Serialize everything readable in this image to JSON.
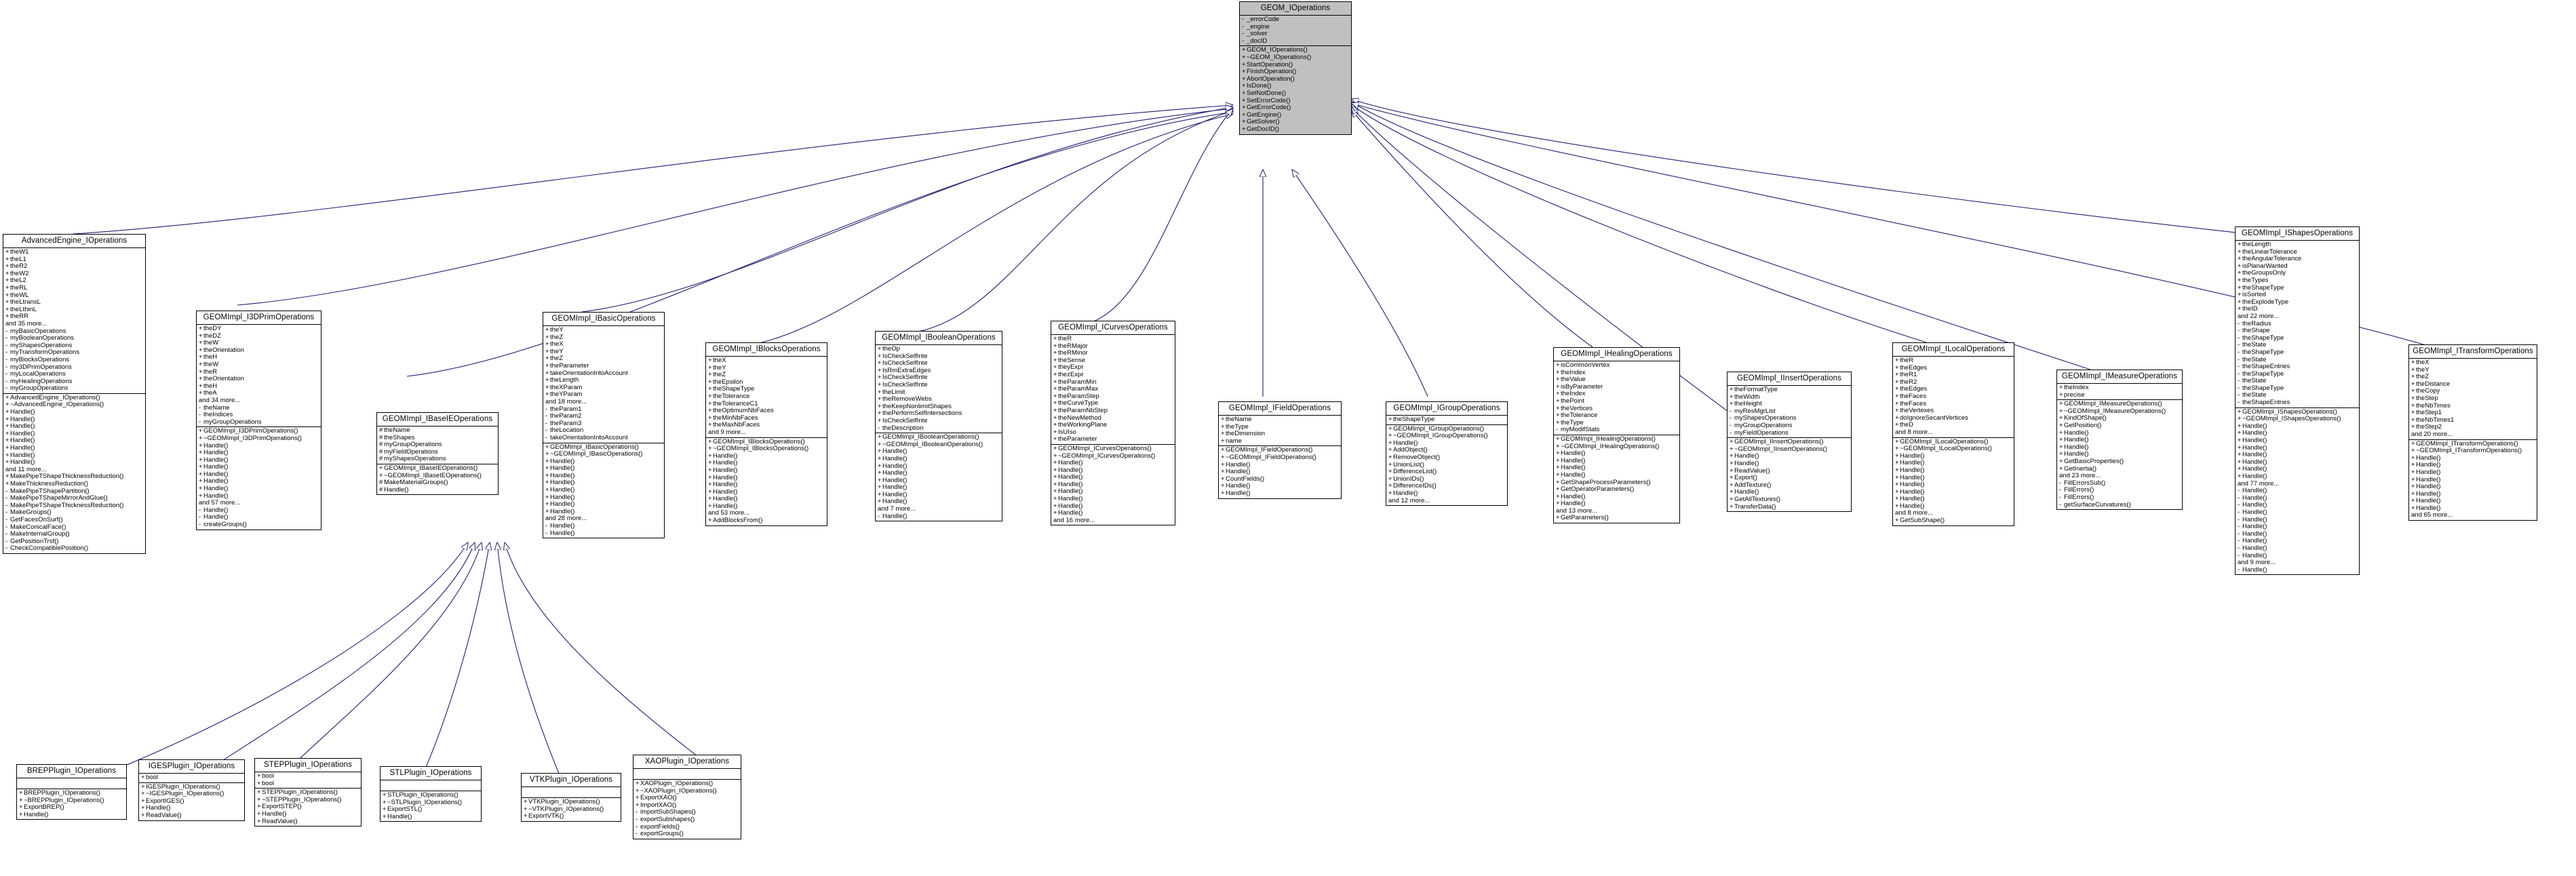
{
  "diagram": {
    "kind": "uml-inheritance-diagram",
    "edge_color": "#1f1f6e",
    "root_fill": "#c0c0c0",
    "node_fill": "#ffffff",
    "border_color": "#000000"
  },
  "nodes": {
    "root": {
      "title": "GEOM_IOperations",
      "attributes": [
        "- _errorCode",
        "- _engine",
        "- _solver",
        "- _docID"
      ],
      "methods": [
        "+ GEOM_IOperations()",
        "+ ~GEOM_IOperations()",
        "+ StartOperation()",
        "+ FinishOperation()",
        "+ AbortOperation()",
        "+ IsDone()",
        "+ SetNotDone()",
        "+ SetErrorCode()",
        "+ GetErrorCode()",
        "+ GetEngine()",
        "+ GetSolver()",
        "+ GetDocID()"
      ]
    },
    "advanced": {
      "title": "AdvancedEngine_IOperations",
      "attributes": [
        "+ theW1",
        "+ theL1",
        "+ theR2",
        "+ theW2",
        "+ theL2",
        "+ theRL",
        "+ theWL",
        "+ theLtransL",
        "+ theLthinL",
        "+ theRR",
        "and 35 more...",
        "- myBasicOperations",
        "- myBooleanOperations",
        "- myShapesOperations",
        "- myTransformOperations",
        "- myBlocksOperations",
        "- my3DPrimOperations",
        "- myLocalOperations",
        "- myHealingOperations",
        "- myGroupOperations"
      ],
      "methods": [
        "+ AdvancedEngine_IOperations()",
        "+ ~AdvancedEngine_IOperations()",
        "+ Handle()",
        "+ Handle()",
        "+ Handle()",
        "+ Handle()",
        "+ Handle()",
        "+ Handle()",
        "+ Handle()",
        "+ Handle()",
        "and 11 more...",
        "+ MakePipeTShapeThicknessReduction()",
        "+ MakeThicknessReduction()",
        "- MakePipeTShapePartition()",
        "- MakePipeTShapeMirrorAndGlue()",
        "- MakePipeTShapeThicknessReduction()",
        "- MakeGroups()",
        "- GetFacesOnSurf()",
        "- MakeConicalFace()",
        "- MakeInternalGroup()",
        "- GetPositionTrsf()",
        "- CheckCompatiblePosition()"
      ]
    },
    "prim3d": {
      "title": "GEOMImpl_I3DPrimOperations",
      "attributes": [
        "+ theDY",
        "+ theDZ",
        "+ theW",
        "+ theOrientation",
        "+ theH",
        "+ theW",
        "+ theR",
        "+ theOrientation",
        "+ theH",
        "+ theA",
        "and 34 more...",
        "- theName",
        "- theIndices",
        "- myGroupOperations"
      ],
      "methods": [
        "+ GEOMImpl_I3DPrimOperations()",
        "+ ~GEOMImpl_I3DPrimOperations()",
        "+ Handle()",
        "+ Handle()",
        "+ Handle()",
        "+ Handle()",
        "+ Handle()",
        "+ Handle()",
        "+ Handle()",
        "+ Handle()",
        "and 57 more...",
        "- Handle()",
        "- Handle()",
        "- createGroups()"
      ]
    },
    "baseIE": {
      "title": "GEOMImpl_IBaseIEOperations",
      "attributes": [
        "# theName",
        "# theShapes",
        "# myGroupOperations",
        "# myFieldOperations",
        "# myShapesOperations"
      ],
      "methods": [
        "+ GEOMImpl_IBaseIEOperations()",
        "+ ~GEOMImpl_IBaseIEOperations()",
        "# MakeMaterialGroups()",
        "# Handle()"
      ]
    },
    "basic": {
      "title": "GEOMImpl_IBasicOperations",
      "attributes": [
        "+ theY",
        "+ theZ",
        "+ theX",
        "+ theY",
        "+ theZ",
        "+ theParameter",
        "+ takeOrientationIntoAccount",
        "+ theLength",
        "+ theXParam",
        "+ theYParam",
        "and 18 more...",
        "- theParam1",
        "- theParam2",
        "- theParam3",
        "- theLocation",
        "- takeOrientationIntoAccount"
      ],
      "methods": [
        "+ GEOMImpl_IBasicOperations()",
        "+ ~GEOMImpl_IBasicOperations()",
        "+ Handle()",
        "+ Handle()",
        "+ Handle()",
        "+ Handle()",
        "+ Handle()",
        "+ Handle()",
        "+ Handle()",
        "+ Handle()",
        "and 28 more...",
        "- Handle()",
        "- Handle()"
      ]
    },
    "blocks": {
      "title": "GEOMImpl_IBlocksOperations",
      "attributes": [
        "+ theX",
        "+ theY",
        "+ theZ",
        "+ theEpsilon",
        "+ theShapeType",
        "+ theTolerance",
        "+ theToleranceC1",
        "+ theOptimumNbFaces",
        "+ theMinNbFaces",
        "+ theMaxNbFaces",
        "and 9 more..."
      ],
      "methods": [
        "+ GEOMImpl_IBlocksOperations()",
        "+ ~GEOMImpl_IBlocksOperations()",
        "+ Handle()",
        "+ Handle()",
        "+ Handle()",
        "+ Handle()",
        "+ Handle()",
        "+ Handle()",
        "+ Handle()",
        "+ Handle()",
        "and 53 more...",
        "+ AddBlocksFrom()"
      ]
    },
    "boolean": {
      "title": "GEOMImpl_IBooleanOperations",
      "attributes": [
        "+ theOp",
        "+ IsCheckSelfInte",
        "+ IsCheckSelfInte",
        "+ IsRmExtraEdges",
        "+ IsCheckSelfInte",
        "+ IsCheckSelfInte",
        "+ theLimit",
        "+ theRemoveWebs",
        "+ theKeepNonlimitShapes",
        "+ thePerformSelfIntersections",
        "+ IsCheckSelfInte",
        "- theDescription"
      ],
      "methods": [
        "+ GEOMImpl_IBooleanOperations()",
        "+ ~GEOMImpl_IBooleanOperations()",
        "+ Handle()",
        "+ Handle()",
        "+ Handle()",
        "+ Handle()",
        "+ Handle()",
        "+ Handle()",
        "+ Handle()",
        "+ Handle()",
        "and 7 more...",
        "- Handle()"
      ]
    },
    "curves": {
      "title": "GEOMImpl_ICurvesOperations",
      "attributes": [
        "+ theR",
        "+ theRMajor",
        "+ theRMinor",
        "+ theSense",
        "+ theyExpr",
        "+ thezExpr",
        "+ theParamMin",
        "+ theParamMax",
        "+ theParamStep",
        "+ theCurveType",
        "+ theParamNbStep",
        "+ theNewMethod",
        "+ theWorkingPlane",
        "+ IsUIso",
        "+ theParameter"
      ],
      "methods": [
        "+ GEOMImpl_ICurvesOperations()",
        "+ ~GEOMImpl_ICurvesOperations()",
        "+ Handle()",
        "+ Handle()",
        "+ Handle()",
        "+ Handle()",
        "+ Handle()",
        "+ Handle()",
        "+ Handle()",
        "+ Handle()",
        "and 16 more..."
      ]
    },
    "field": {
      "title": "GEOMImpl_IFieldOperations",
      "attributes": [
        "+ theName",
        "+ theType",
        "+ theDimension",
        "+ name"
      ],
      "methods": [
        "+ GEOMImpl_IFieldOperations()",
        "+ ~GEOMImpl_IFieldOperations()",
        "+ Handle()",
        "+ Handle()",
        "+ CountFields()",
        "+ Handle()",
        "+ Handle()"
      ]
    },
    "group": {
      "title": "GEOMImpl_IGroupOperations",
      "attributes": [
        "+ theShapeType"
      ],
      "methods": [
        "+ GEOMImpl_IGroupOperations()",
        "+ ~GEOMImpl_IGroupOperations()",
        "+ Handle()",
        "+ AddObject()",
        "+ RemoveObject()",
        "+ UnionList()",
        "+ DifferenceList()",
        "+ UnionIDs()",
        "+ DifferenceIDs()",
        "+ Handle()",
        "and 12 more..."
      ]
    },
    "healing": {
      "title": "GEOMImpl_IHealingOperations",
      "attributes": [
        "+ isCommonVertex",
        "+ theIndex",
        "+ theValue",
        "+ isByParameter",
        "+ theIndex",
        "+ thePoint",
        "+ theVertices",
        "+ theTolerance",
        "+ theType",
        "- myModifStats"
      ],
      "methods": [
        "+ GEOMImpl_IHealingOperations()",
        "+ ~GEOMImpl_IHealingOperations()",
        "+ Handle()",
        "+ Handle()",
        "+ Handle()",
        "+ Handle()",
        "+ GetShapeProcessParameters()",
        "+ GetOperatorParameters()",
        "+ Handle()",
        "+ Handle()",
        "and 13 more...",
        "+ GetParameters()"
      ]
    },
    "insert": {
      "title": "GEOMImpl_IInsertOperations",
      "attributes": [
        "+ theFormatType",
        "+ theWidth",
        "+ theHeight",
        "- myResMgrList",
        "- myShapesOperations",
        "- myGroupOperations",
        "- myFieldOperations"
      ],
      "methods": [
        "+ GEOMImpl_IInsertOperations()",
        "+ ~GEOMImpl_IInsertOperations()",
        "+ Handle()",
        "+ Handle()",
        "+ ReadValue()",
        "+ Export()",
        "+ AddTexture()",
        "+ Handle()",
        "+ GetAllTextures()",
        "+ TransferData()"
      ]
    },
    "local": {
      "title": "GEOMImpl_ILocalOperations",
      "attributes": [
        "+ theR",
        "+ theEdges",
        "+ theR1",
        "+ theR2",
        "+ theEdges",
        "+ theFaces",
        "+ theFaces",
        "+ theVertexes",
        "+ doIgnoreSecantVertices",
        "+ theD",
        "and 8 more..."
      ],
      "methods": [
        "+ GEOMImpl_ILocalOperations()",
        "+ ~GEOMImpl_ILocalOperations()",
        "+ Handle()",
        "+ Handle()",
        "+ Handle()",
        "+ Handle()",
        "+ Handle()",
        "+ Handle()",
        "+ Handle()",
        "+ Handle()",
        "and 8 more...",
        "+ GetSubShape()"
      ]
    },
    "measure": {
      "title": "GEOMImpl_IMeasureOperations",
      "attributes": [
        "+ theIndex",
        "+ precise"
      ],
      "methods": [
        "+ GEOMImpl_IMeasureOperations()",
        "+ ~GEOMImpl_IMeasureOperations()",
        "+ KindOfShape()",
        "+ GetPosition()",
        "+ Handle()",
        "+ Handle()",
        "+ Handle()",
        "+ Handle()",
        "+ GetBasicProperties()",
        "+ GetInertia()",
        "and 23 more...",
        "- FillErrorsSub()",
        "- FillErrors()",
        "- FillErrors()",
        "- getSurfaceCurvatures()"
      ]
    },
    "shapes": {
      "title": "GEOMImpl_IShapesOperations",
      "attributes": [
        "+ theLength",
        "+ theLinearTolerance",
        "+ theAngularTolerance",
        "+ isPlanarWanted",
        "+ theGroupsOnly",
        "+ theTypes",
        "+ theShapeType",
        "+ isSorted",
        "+ theExplodeType",
        "+ theID",
        "and 22 more...",
        "- theRadius",
        "- theShape",
        "- theShapeType",
        "- theState",
        "- theShapeType",
        "- theState",
        "- theShapeEntries",
        "- theShapeType",
        "- theState",
        "- theShapeType",
        "- theState",
        "- theShapeEntries"
      ],
      "methods": [
        "+ GEOMImpl_IShapesOperations()",
        "+ ~GEOMImpl_IShapesOperations()",
        "+ Handle()",
        "+ Handle()",
        "+ Handle()",
        "+ Handle()",
        "+ Handle()",
        "+ Handle()",
        "+ Handle()",
        "+ Handle()",
        "and 77 more...",
        "- Handle()",
        "- Handle()",
        "- Handle()",
        "- Handle()",
        "- Handle()",
        "- Handle()",
        "- Handle()",
        "- Handle()",
        "- Handle()",
        "- Handle()",
        "and 9 more...",
        "- Handle()"
      ]
    },
    "transform": {
      "title": "GEOMImpl_ITransformOperations",
      "attributes": [
        "+ theX",
        "+ theY",
        "+ theZ",
        "+ theDistance",
        "+ theCopy",
        "+ theStep",
        "+ theNbTimes",
        "+ theStep1",
        "+ theNbTimes1",
        "+ theStep2",
        "and 20 more..."
      ],
      "methods": [
        "+ GEOMImpl_ITransformOperations()",
        "+ ~GEOMImpl_ITransformOperations()",
        "+ Handle()",
        "+ Handle()",
        "+ Handle()",
        "+ Handle()",
        "+ Handle()",
        "+ Handle()",
        "+ Handle()",
        "+ Handle()",
        "and 65 more..."
      ]
    },
    "brep": {
      "title": "BREPPlugin_IOperations",
      "attributes": [],
      "methods": [
        "+ BREPPlugin_IOperations()",
        "+ ~BREPPlugin_IOperations()",
        "+ ExportBREP()",
        "+ Handle()"
      ]
    },
    "iges": {
      "title": "IGESPlugin_IOperations",
      "attributes": [
        "+ bool"
      ],
      "methods": [
        "+ IGESPlugin_IOperations()",
        "+ ~IGESPlugin_IOperations()",
        "+ ExportIGES()",
        "+ Handle()",
        "+ ReadValue()"
      ]
    },
    "step": {
      "title": "STEPPlugin_IOperations",
      "attributes": [
        "+ bool",
        "+ bool"
      ],
      "methods": [
        "+ STEPPlugin_IOperations()",
        "+ ~STEPPlugin_IOperations()",
        "+ ExportSTEP()",
        "+ Handle()",
        "+ ReadValue()"
      ]
    },
    "stl": {
      "title": "STLPlugin_IOperations",
      "attributes": [],
      "methods": [
        "+ STLPlugin_IOperations()",
        "+ ~STLPlugin_IOperations()",
        "+ ExportSTL()",
        "+ Handle()"
      ]
    },
    "vtk": {
      "title": "VTKPlugin_IOperations",
      "attributes": [],
      "methods": [
        "+ VTKPlugin_IOperations()",
        "+ ~VTKPlugin_IOperations()",
        "+ ExportVTK()"
      ]
    },
    "xao": {
      "title": "XAOPlugin_IOperations",
      "attributes": [],
      "methods": [
        "+ XAOPlugin_IOperations()",
        "+ ~XAOPlugin_IOperations()",
        "+ ExportXAO()",
        "+ ImportXAO()",
        "- importSubShapes()",
        "- exportSubshapes()",
        "- exportFields()",
        "- exportGroups()"
      ]
    }
  }
}
